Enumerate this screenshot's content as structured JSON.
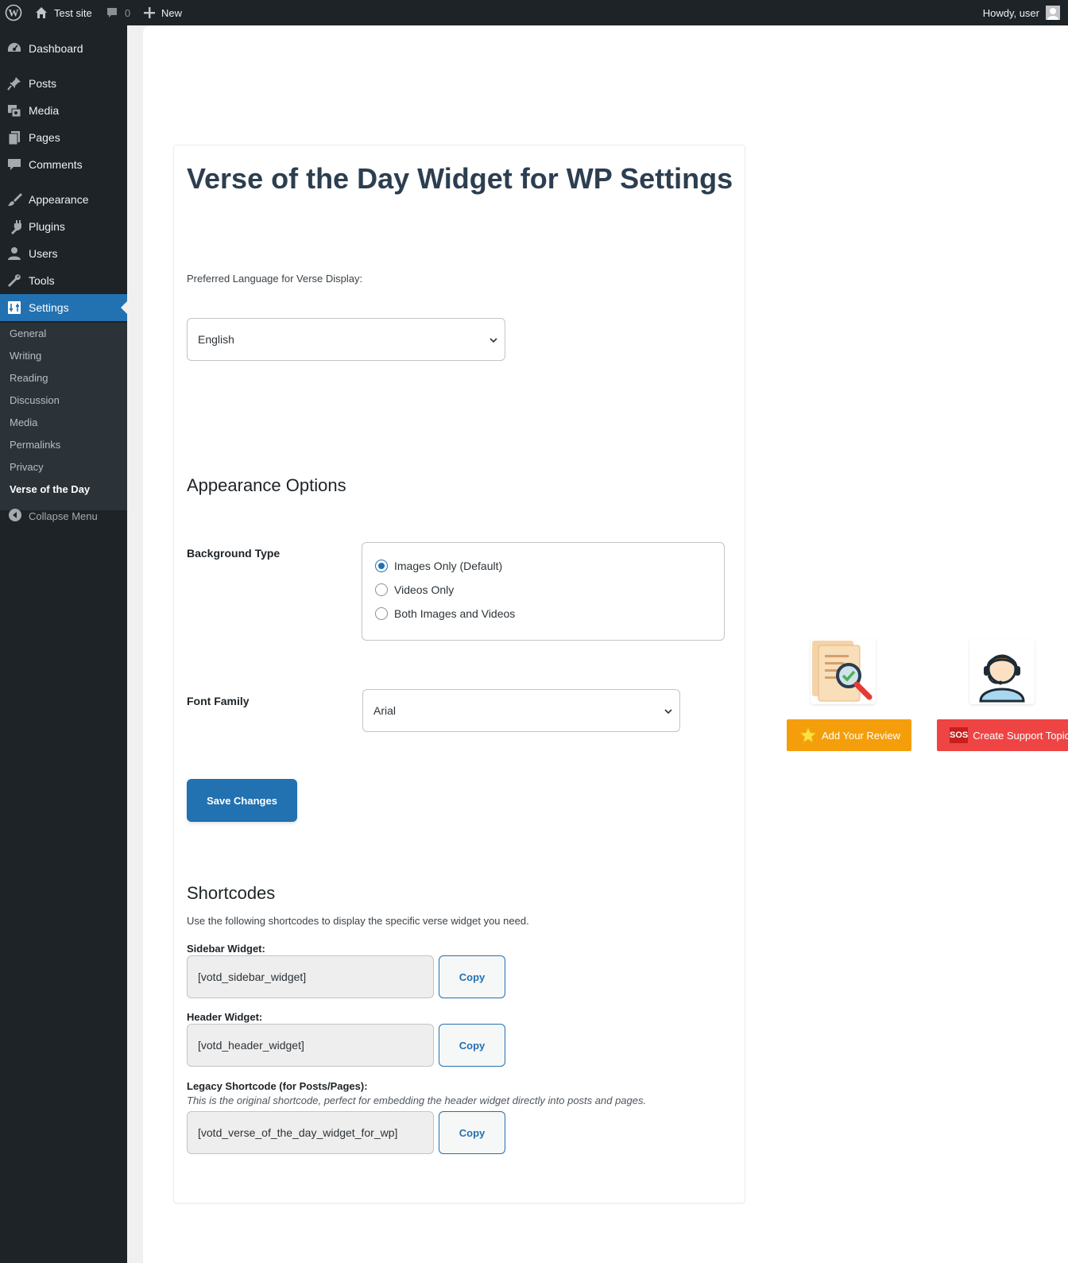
{
  "admin_bar": {
    "site_name": "Test site",
    "comments_count": "0",
    "new_label": "New",
    "howdy": "Howdy, user"
  },
  "sidebar": {
    "items": [
      {
        "label": "Dashboard",
        "icon": "dashboard-icon"
      },
      {
        "label": "Posts",
        "icon": "pin-icon"
      },
      {
        "label": "Media",
        "icon": "media-icon"
      },
      {
        "label": "Pages",
        "icon": "pages-icon"
      },
      {
        "label": "Comments",
        "icon": "comment-icon"
      },
      {
        "label": "Appearance",
        "icon": "brush-icon"
      },
      {
        "label": "Plugins",
        "icon": "plugin-icon"
      },
      {
        "label": "Users",
        "icon": "user-icon"
      },
      {
        "label": "Tools",
        "icon": "wrench-icon"
      },
      {
        "label": "Settings",
        "icon": "settings-icon"
      }
    ],
    "submenu": [
      "General",
      "Writing",
      "Reading",
      "Discussion",
      "Media",
      "Permalinks",
      "Privacy",
      "Verse of the Day"
    ],
    "collapse_label": "Collapse Menu"
  },
  "page": {
    "title": "Verse of the Day Widget for WP Settings",
    "language_label": "Preferred Language for Verse Display:",
    "language_value": "English",
    "appearance_heading": "Appearance Options",
    "background_type_label": "Background Type",
    "background_options": [
      {
        "label": "Images Only (Default)",
        "checked": true
      },
      {
        "label": "Videos Only",
        "checked": false
      },
      {
        "label": "Both Images and Videos",
        "checked": false
      }
    ],
    "font_family_label": "Font Family",
    "font_family_value": "Arial",
    "save_label": "Save Changes",
    "shortcodes_heading": "Shortcodes",
    "shortcodes_desc": "Use the following shortcodes to display the specific verse widget you need.",
    "sidebar_widget_label": "Sidebar Widget:",
    "sidebar_widget_code": "[votd_sidebar_widget]",
    "header_widget_label": "Header Widget:",
    "header_widget_code": "[votd_header_widget]",
    "legacy_label": "Legacy Shortcode (for Posts/Pages):",
    "legacy_desc": "This is the original shortcode, perfect for embedding the header widget directly into posts and pages.",
    "legacy_code": "[votd_verse_of_the_day_widget_for_wp]",
    "copy_label": "Copy"
  },
  "promo": {
    "review_label": "Add Your Review",
    "support_label": "Create Support Topic",
    "sos_label": "SOS",
    "review_color": "#f59e0b",
    "support_color": "#ef4444"
  },
  "colors": {
    "accent": "#2271b1",
    "admin_bg": "#1d2327"
  }
}
